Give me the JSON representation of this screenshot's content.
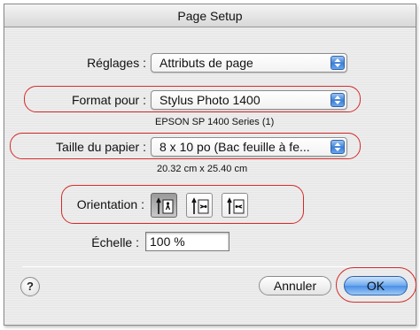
{
  "window": {
    "title": "Page Setup"
  },
  "settings": {
    "label": "Réglages :",
    "value": "Attributs de page"
  },
  "format": {
    "label": "Format pour :",
    "value": "Stylus Photo 1400",
    "sublabel": "EPSON SP 1400 Series (1)"
  },
  "paper": {
    "label": "Taille du papier :",
    "value": "8 x 10 po (Bac feuille à fe...",
    "dimensions": "20.32 cm x 25.40 cm"
  },
  "orientation": {
    "label": "Orientation :",
    "options": [
      {
        "icon": "portrait-icon",
        "selected": true
      },
      {
        "icon": "landscape-icon",
        "selected": false
      },
      {
        "icon": "landscape-reversed-icon",
        "selected": false
      }
    ]
  },
  "scale": {
    "label": "Échelle :",
    "value": "100 %"
  },
  "buttons": {
    "help": "?",
    "cancel": "Annuler",
    "ok": "OK"
  },
  "colors": {
    "highlight": "#d42a2a",
    "accent": "#3c7fd6"
  }
}
